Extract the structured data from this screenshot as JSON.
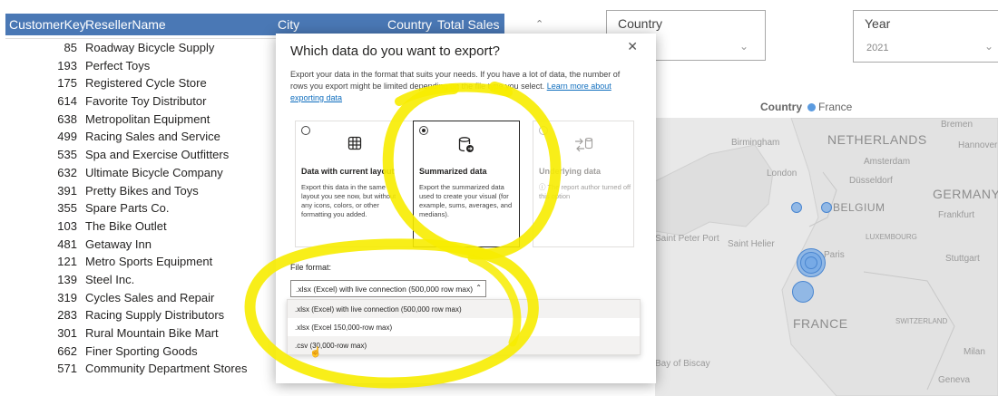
{
  "table": {
    "headers": [
      "CustomerKey",
      "ResellerName",
      "City",
      "Country",
      "Total Sales"
    ],
    "rows": [
      {
        "key": "85",
        "name": "Roadway Bicycle Supply"
      },
      {
        "key": "193",
        "name": "Perfect Toys"
      },
      {
        "key": "175",
        "name": "Registered Cycle Store"
      },
      {
        "key": "614",
        "name": "Favorite Toy Distributor"
      },
      {
        "key": "638",
        "name": "Metropolitan Equipment"
      },
      {
        "key": "499",
        "name": "Racing Sales and Service"
      },
      {
        "key": "535",
        "name": "Spa and Exercise Outfitters"
      },
      {
        "key": "632",
        "name": "Ultimate Bicycle Company"
      },
      {
        "key": "391",
        "name": "Pretty Bikes and Toys"
      },
      {
        "key": "355",
        "name": "Spare Parts Co."
      },
      {
        "key": "103",
        "name": "The Bike Outlet"
      },
      {
        "key": "481",
        "name": "Getaway Inn"
      },
      {
        "key": "121",
        "name": "Metro Sports Equipment"
      },
      {
        "key": "139",
        "name": "Steel Inc."
      },
      {
        "key": "319",
        "name": "Cycles Sales and Repair"
      },
      {
        "key": "283",
        "name": "Racing Supply Distributors"
      },
      {
        "key": "301",
        "name": "Rural Mountain Bike Mart"
      },
      {
        "key": "662",
        "name": "Finer Sporting Goods"
      },
      {
        "key": "571",
        "name": "Community Department Stores"
      }
    ]
  },
  "slicers": {
    "country": {
      "title": "Country",
      "value": ""
    },
    "year": {
      "title": "Year",
      "value": "2021"
    }
  },
  "map": {
    "legend_title": "Country",
    "legend_item": "France",
    "series_color": "#5b9be0",
    "labels": {
      "birmingham": "Birmingham",
      "netherlands": "NETHERLANDS",
      "bremen": "Bremen",
      "hannover": "Hannover",
      "amsterdam": "Amsterdam",
      "london": "London",
      "dusseldorf": "Düsseldorf",
      "germany": "GERMANY",
      "belgium": "BELGIUM",
      "frankfurt": "Frankfurt",
      "luxembourg": "LUXEMBOURG",
      "saint_peter_port": "Saint Peter Port",
      "saint_helier": "Saint Helier",
      "paris": "Paris",
      "stuttgart": "Stuttgart",
      "france": "FRANCE",
      "switzerland": "SWITZERLAND",
      "bay_of_biscay": "Bay of Biscay",
      "milan": "Milan",
      "geneva": "Geneva"
    }
  },
  "dialog": {
    "title": "Which data do you want to export?",
    "close_icon": "close-icon",
    "description": "Export your data in the format that suits your needs. If you have a lot of data, the number of rows you export might be limited depending on the file type you select.",
    "link": "Learn more about exporting data",
    "options": [
      {
        "title": "Data with current layout",
        "desc": "Export this data in the same layout you see now, but without any icons, colors, or other formatting you added.",
        "icon": "table-grid-icon",
        "state": "unselected"
      },
      {
        "title": "Summarized data",
        "desc": "Export the summarized data used to create your visual (for example, sums, averages, and medians).",
        "icon": "database-export-icon",
        "state": "selected"
      },
      {
        "title": "Underlying data",
        "desc": "The report author turned off this option",
        "icon": "data-transfer-icon",
        "state": "disabled"
      }
    ],
    "file_format_label": "File format:",
    "file_format_value": ".xlsx (Excel) with live connection (500,000 row max)",
    "file_format_options": [
      ".xlsx (Excel) with live connection (500,000 row max)",
      ".xlsx (Excel 150,000-row max)",
      ".csv (30,000-row max)"
    ]
  },
  "colors": {
    "table_header": "#4a78b5",
    "highlight_marker": "#f7ec00",
    "link": "#106ebe"
  }
}
